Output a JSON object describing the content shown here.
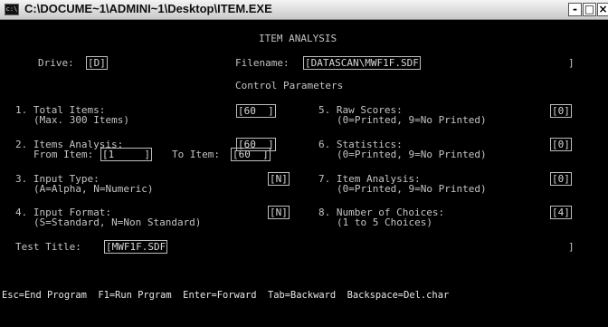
{
  "window": {
    "title": "C:\\DOCUME~1\\ADMINI~1\\Desktop\\ITEM.EXE",
    "app_icon": "c:\\",
    "controls": {
      "minimize": "-",
      "restore": "□",
      "close": "×"
    }
  },
  "screen": {
    "header": "ITEM ANALYSIS",
    "drive_label": "Drive:",
    "drive_value": "[D]",
    "filename_label": "Filename:",
    "filename_value": "[DATASCAN\\MWF1F.SDF",
    "filename_close": "]",
    "control_params": "Control Parameters",
    "p1_line1": "1. Total Items:",
    "p1_line2": "(Max. 300 Items)",
    "p1_value": "[60  ]",
    "p2_line1": "2. Items Analysis:",
    "p2_line2_a": "From Item:",
    "p2_from_value": "[1     ]",
    "p2_line2_b": "To Item:",
    "p2_to_value": "[60  ]",
    "p2_value": "[60  ]",
    "p3_line1": "3. Input Type:",
    "p3_line2": "(A=Alpha, N=Numeric)",
    "p3_value": "[N]",
    "p4_line1": "4. Input Format:",
    "p4_line2": "(S=Standard, N=Non Standard)",
    "p4_value": "[N]",
    "p5_line1": "5. Raw Scores:",
    "p5_line2": "(0=Printed, 9=No Printed)",
    "p5_value": "[0]",
    "p6_line1": "6. Statistics:",
    "p6_line2": "(0=Printed, 9=No Printed)",
    "p6_value": "[0]",
    "p7_line1": "7. Item Analysis:",
    "p7_line2": "(0=Printed, 9=No Printed)",
    "p7_value": "[0]",
    "p8_line1": "8. Number of Choices:",
    "p8_line2": "(1 to 5 Choices)",
    "p8_value": "[4]",
    "test_title_label": "Test Title:",
    "test_title_value": "[MWF1F.SDF",
    "test_title_close": "]",
    "footer": "Esc=End Program  F1=Run Prgram  Enter=Forward  Tab=Backward  Backspace=Del.char"
  }
}
